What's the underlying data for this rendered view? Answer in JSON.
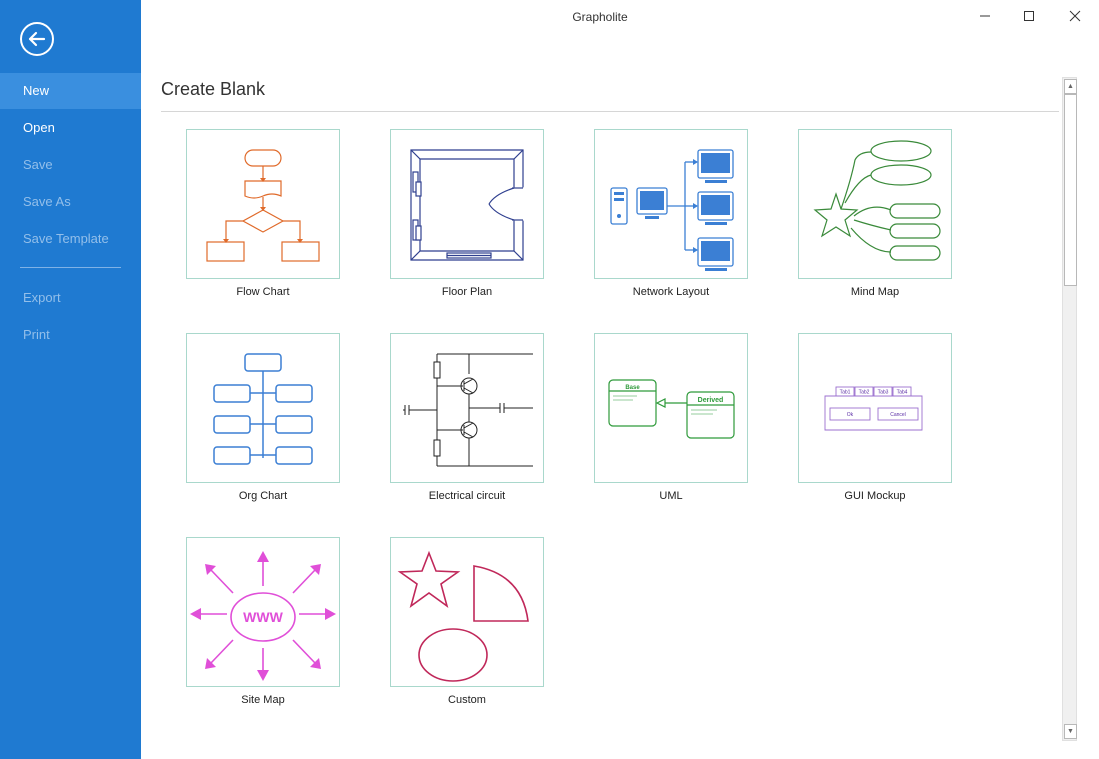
{
  "window": {
    "title": "Grapholite"
  },
  "sidebar": {
    "items": [
      {
        "label": "New"
      },
      {
        "label": "Open"
      },
      {
        "label": "Save"
      },
      {
        "label": "Save As"
      },
      {
        "label": "Save Template"
      },
      {
        "label": "Export"
      },
      {
        "label": "Print"
      }
    ]
  },
  "main": {
    "section_title": "Create Blank",
    "templates": [
      {
        "label": "Flow Chart"
      },
      {
        "label": "Floor Plan"
      },
      {
        "label": "Network Layout"
      },
      {
        "label": "Mind Map"
      },
      {
        "label": "Org Chart"
      },
      {
        "label": "Electrical circuit"
      },
      {
        "label": "UML"
      },
      {
        "label": "GUI Mockup"
      },
      {
        "label": "Site Map"
      },
      {
        "label": "Custom"
      }
    ],
    "uml": {
      "base": "Base",
      "derived": "Derived"
    },
    "gui": {
      "tabs": [
        "Tab1",
        "Tab2",
        "Tab3",
        "Tab4"
      ],
      "ok": "Ok",
      "cancel": "Cancel"
    },
    "sitemap": {
      "center": "WWW"
    }
  },
  "colors": {
    "sidebar_bg": "#1f7ad1",
    "flow": "#e06a2a",
    "floor": "#2f3f8f",
    "network": "#3b7fd4",
    "mind": "#3a8a3a",
    "org": "#3b7fd4",
    "uml": "#2e9a3a",
    "gui": "#9b6fcf",
    "sitemap": "#e04fd8",
    "custom": "#c0285a"
  }
}
